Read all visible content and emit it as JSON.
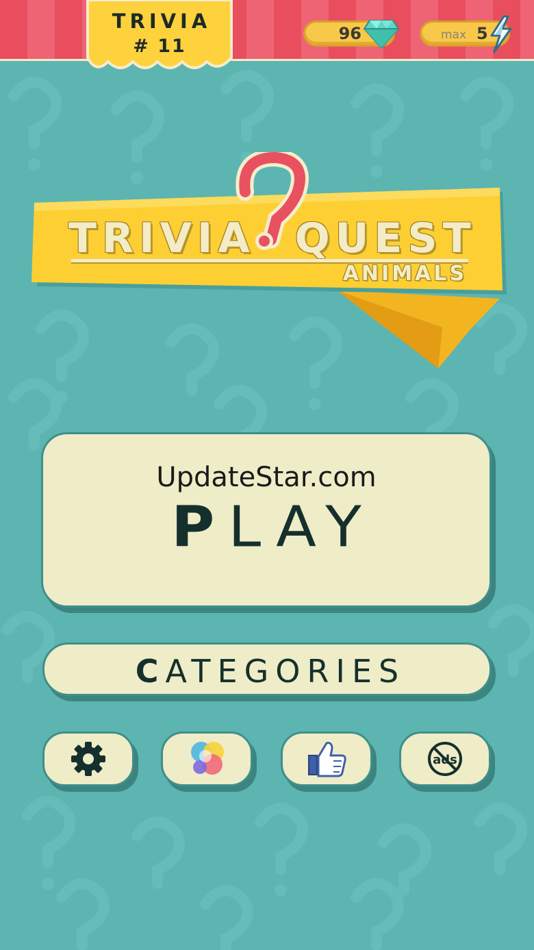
{
  "header": {
    "badge_title": "TRIVIA",
    "badge_number": "# 11",
    "gems": "96",
    "energy_max_label": "max",
    "energy": "5"
  },
  "logo": {
    "word_left": "Trivia",
    "word_right": "Quest",
    "subtitle": "Animals"
  },
  "buttons": {
    "watermark": "UpdateStar.com",
    "play": "PLAY",
    "categories": "CATEGORIES"
  },
  "icons": [
    "gear-icon",
    "color-circles-icon",
    "thumbs-up-icon",
    "no-ads-icon"
  ],
  "colors": {
    "background": "#5db5b1",
    "header_red": "#e84e5e",
    "accent_yellow": "#fdcf33",
    "button_cream": "#efecc8",
    "question_red": "#e8515f"
  }
}
